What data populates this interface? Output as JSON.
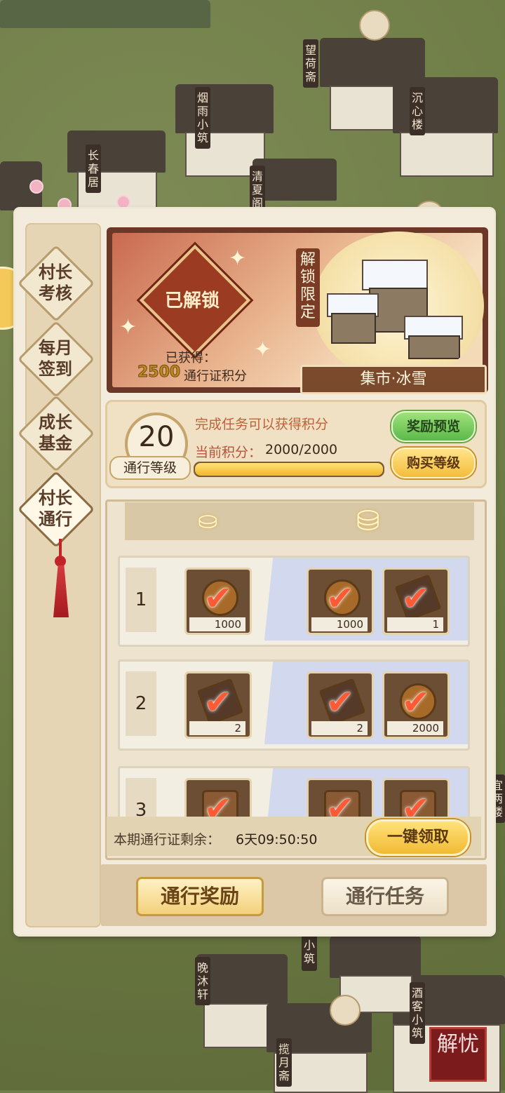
{
  "background": {
    "signs": [
      "长春居",
      "烟雨小筑",
      "望荷斋",
      "沉心楼",
      "清夏阁",
      "宜两楼",
      "晚沐轩",
      "揽月斋",
      "酒客小筑",
      "小筑"
    ],
    "seal_text": "解忧"
  },
  "sidebar": {
    "items": [
      {
        "line1": "村长",
        "line2": "考核"
      },
      {
        "line1": "每月",
        "line2": "签到"
      },
      {
        "line1": "成长",
        "line2": "基金"
      },
      {
        "line1": "村长",
        "line2": "通行"
      }
    ],
    "active_index": 3
  },
  "banner": {
    "status": "已解锁",
    "earned_label": "已获得：",
    "earned_points": "2500",
    "earned_unit": "通行证积分",
    "limited_tag": "解锁限定",
    "skin_name": "集市·冰雪"
  },
  "level": {
    "level_number": "20",
    "level_label": "通行等级",
    "task_hint": "完成任务可以获得积分",
    "current_label": "当前积分：",
    "current_value": "2000/2000",
    "progress": 1.0,
    "preview_button": "奖励预览",
    "buy_button": "购买等级"
  },
  "rewards": {
    "rows": [
      {
        "level": "1",
        "free": {
          "icon": "coin-icon",
          "count": "1000"
        },
        "premium": [
          {
            "icon": "coin-icon",
            "count": "1000"
          },
          {
            "icon": "book-icon",
            "count": "1"
          }
        ]
      },
      {
        "level": "2",
        "free": {
          "icon": "book-icon",
          "count": "2"
        },
        "premium": [
          {
            "icon": "book-icon",
            "count": "2"
          },
          {
            "icon": "coin-icon",
            "count": "2000"
          }
        ]
      },
      {
        "level": "3",
        "free": {
          "icon": "wood-icon",
          "count": ""
        },
        "premium": [
          {
            "icon": "wood-icon",
            "count": ""
          },
          {
            "icon": "bundle-icon",
            "count": ""
          }
        ]
      }
    ],
    "remaining_label": "本期通行证剩余：",
    "remaining_value": "6天09:50:50",
    "claim_all_button": "一键领取"
  },
  "bottom_tabs": {
    "reward_tab": "通行奖励",
    "task_tab": "通行任务"
  },
  "colors": {
    "accent_red": "#9b3b22",
    "gold": "#f1ba34",
    "green": "#5cb84a",
    "panel": "#f3ecdc"
  }
}
